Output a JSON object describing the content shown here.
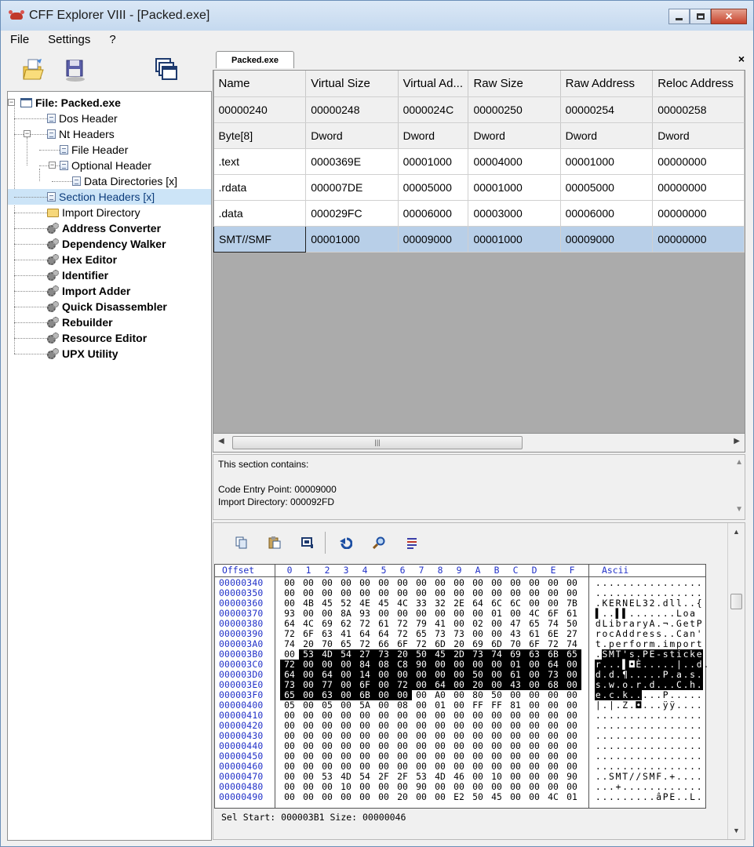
{
  "window": {
    "title": "CFF Explorer VIII - [Packed.exe]",
    "controls": {
      "minimize": "minimize",
      "maximize": "maximize",
      "close": "✕"
    }
  },
  "menu": [
    "File",
    "Settings",
    "?"
  ],
  "toolbar_icons": [
    "open-file-icon",
    "save-disk-icon",
    "windows-cascade-icon"
  ],
  "tree": [
    {
      "label": "File: Packed.exe",
      "icon": "window-icon",
      "bold": true,
      "depth": 0,
      "expander": "⊟"
    },
    {
      "label": "Dos Header",
      "icon": "doc-icon",
      "bold": false,
      "depth": 1
    },
    {
      "label": "Nt Headers",
      "icon": "doc-icon",
      "bold": false,
      "depth": 1,
      "expander": "⊟"
    },
    {
      "label": "File Header",
      "icon": "doc-icon",
      "bold": false,
      "depth": 2
    },
    {
      "label": "Optional Header",
      "icon": "doc-icon",
      "bold": false,
      "depth": 2,
      "expander": "⊟"
    },
    {
      "label": "Data Directories [x]",
      "icon": "doc-icon",
      "bold": false,
      "depth": 3
    },
    {
      "label": "Section Headers [x]",
      "icon": "doc-icon",
      "bold": false,
      "depth": 1,
      "selected": true
    },
    {
      "label": "Import Directory",
      "icon": "folder-icon",
      "bold": false,
      "depth": 1
    },
    {
      "label": "Address Converter",
      "icon": "gear-icon",
      "bold": true,
      "depth": 1
    },
    {
      "label": "Dependency Walker",
      "icon": "gear-icon",
      "bold": true,
      "depth": 1
    },
    {
      "label": "Hex Editor",
      "icon": "gear-icon",
      "bold": true,
      "depth": 1
    },
    {
      "label": "Identifier",
      "icon": "gear-icon",
      "bold": true,
      "depth": 1
    },
    {
      "label": "Import Adder",
      "icon": "gear-icon",
      "bold": true,
      "depth": 1
    },
    {
      "label": "Quick Disassembler",
      "icon": "gear-icon",
      "bold": true,
      "depth": 1
    },
    {
      "label": "Rebuilder",
      "icon": "gear-icon",
      "bold": true,
      "depth": 1
    },
    {
      "label": "Resource Editor",
      "icon": "gear-icon",
      "bold": true,
      "depth": 1
    },
    {
      "label": "UPX Utility",
      "icon": "gear-icon",
      "bold": true,
      "depth": 1
    }
  ],
  "tab": {
    "label": "Packed.exe",
    "close": "×"
  },
  "section_table": {
    "headers": [
      "Name",
      "Virtual Size",
      "Virtual Ad...",
      "Raw Size",
      "Raw Address",
      "Reloc Address"
    ],
    "offsets": [
      "00000240",
      "00000248",
      "0000024C",
      "00000250",
      "00000254",
      "00000258"
    ],
    "types": [
      "Byte[8]",
      "Dword",
      "Dword",
      "Dword",
      "Dword",
      "Dword"
    ],
    "rows": [
      [
        ".text",
        "0000369E",
        "00001000",
        "00004000",
        "00001000",
        "00000000"
      ],
      [
        ".rdata",
        "000007DE",
        "00005000",
        "00001000",
        "00005000",
        "00000000"
      ],
      [
        ".data",
        "000029FC",
        "00006000",
        "00003000",
        "00006000",
        "00000000"
      ],
      [
        "SMT//SMF",
        "00001000",
        "00009000",
        "00001000",
        "00009000",
        "00000000"
      ]
    ],
    "selected_row": 3
  },
  "info": {
    "line1": "This section contains:",
    "line2": "",
    "line3": "Code Entry Point: 00009000",
    "line4": "Import Directory: 000092FD"
  },
  "hex_toolbar": [
    "copy-icon",
    "paste-icon",
    "fill-icon",
    "undo-icon",
    "search-icon",
    "goto-icon"
  ],
  "hex": {
    "header_offset": "Offset",
    "header_cols": [
      "0",
      "1",
      "2",
      "3",
      "4",
      "5",
      "6",
      "7",
      "8",
      "9",
      "A",
      "B",
      "C",
      "D",
      "E",
      "F"
    ],
    "header_ascii": "Ascii",
    "rows": [
      {
        "off": "00000340",
        "b": "00 00 00 00 00 00 00 00 00 00 00 00 00 00 00 00",
        "a": "................",
        "hl": []
      },
      {
        "off": "00000350",
        "b": "00 00 00 00 00 00 00 00 00 00 00 00 00 00 00 00",
        "a": "................",
        "hl": []
      },
      {
        "off": "00000360",
        "b": "00 4B 45 52 4E 45 4C 33 32 2E 64 6C 6C 00 00 7B",
        "a": ".KERNEL32.dll..{",
        "hl": []
      },
      {
        "off": "00000370",
        "b": "93 00 00 8A 93 00 00 00 00 00 00 01 00 4C 6F 61",
        "a": "▌..▌▌.......Loa",
        "hl": []
      },
      {
        "off": "00000380",
        "b": "64 4C 69 62 72 61 72 79 41 00 02 00 47 65 74 50",
        "a": "dLibraryA.¬.GetP",
        "hl": []
      },
      {
        "off": "00000390",
        "b": "72 6F 63 41 64 64 72 65 73 73 00 00 43 61 6E 27",
        "a": "rocAddress..Can'",
        "hl": []
      },
      {
        "off": "000003A0",
        "b": "74 20 70 65 72 66 6F 72 6D 20 69 6D 70 6F 72 74",
        "a": "t.perform.import",
        "hl": []
      },
      {
        "off": "000003B0",
        "b": "00 53 4D 54 27 73 20 50 45 2D 73 74 69 63 6B 65",
        "a": ".SMT's.PE-sticke",
        "hl": [
          1,
          15
        ]
      },
      {
        "off": "000003C0",
        "b": "72 00 00 00 84 08 C8 90 00 00 00 00 01 00 64 00",
        "a": "r...▌◘È.....|..d.",
        "hl": [
          0,
          15
        ]
      },
      {
        "off": "000003D0",
        "b": "64 00 64 00 14 00 00 00 00 00 50 00 61 00 73 00",
        "a": "d.d.¶.....P.a.s.",
        "hl": [
          0,
          15
        ]
      },
      {
        "off": "000003E0",
        "b": "73 00 77 00 6F 00 72 00 64 00 20 00 43 00 68 00",
        "a": "s.w.o.r.d...C.h.",
        "hl": [
          0,
          15
        ]
      },
      {
        "off": "000003F0",
        "b": "65 00 63 00 6B 00 00 00 A0 00 80 50 00 00 00 00",
        "a": "e.c.k.....P.....",
        "hl": [
          0,
          6
        ]
      },
      {
        "off": "00000400",
        "b": "05 00 05 00 5A 00 08 00 01 00 FF FF 81 00 00 00",
        "a": "|.|.Z.◘...ÿÿ....",
        "hl": []
      },
      {
        "off": "00000410",
        "b": "00 00 00 00 00 00 00 00 00 00 00 00 00 00 00 00",
        "a": "................",
        "hl": []
      },
      {
        "off": "00000420",
        "b": "00 00 00 00 00 00 00 00 00 00 00 00 00 00 00 00",
        "a": "................",
        "hl": []
      },
      {
        "off": "00000430",
        "b": "00 00 00 00 00 00 00 00 00 00 00 00 00 00 00 00",
        "a": "................",
        "hl": []
      },
      {
        "off": "00000440",
        "b": "00 00 00 00 00 00 00 00 00 00 00 00 00 00 00 00",
        "a": "................",
        "hl": []
      },
      {
        "off": "00000450",
        "b": "00 00 00 00 00 00 00 00 00 00 00 00 00 00 00 00",
        "a": "................",
        "hl": []
      },
      {
        "off": "00000460",
        "b": "00 00 00 00 00 00 00 00 00 00 00 00 00 00 00 00",
        "a": "................",
        "hl": []
      },
      {
        "off": "00000470",
        "b": "00 00 53 4D 54 2F 2F 53 4D 46 00 10 00 00 00 90",
        "a": "..SMT//SMF.+....",
        "hl": []
      },
      {
        "off": "00000480",
        "b": "00 00 00 10 00 00 00 90 00 00 00 00 00 00 00 00",
        "a": "...+............",
        "hl": []
      },
      {
        "off": "00000490",
        "b": "00 00 00 00 00 00 20 00 00 E2 50 45 00 00 4C 01",
        "a": ".........âPE..L.",
        "hl": []
      }
    ],
    "status": "Sel Start: 000003B1    Size: 00000046"
  }
}
